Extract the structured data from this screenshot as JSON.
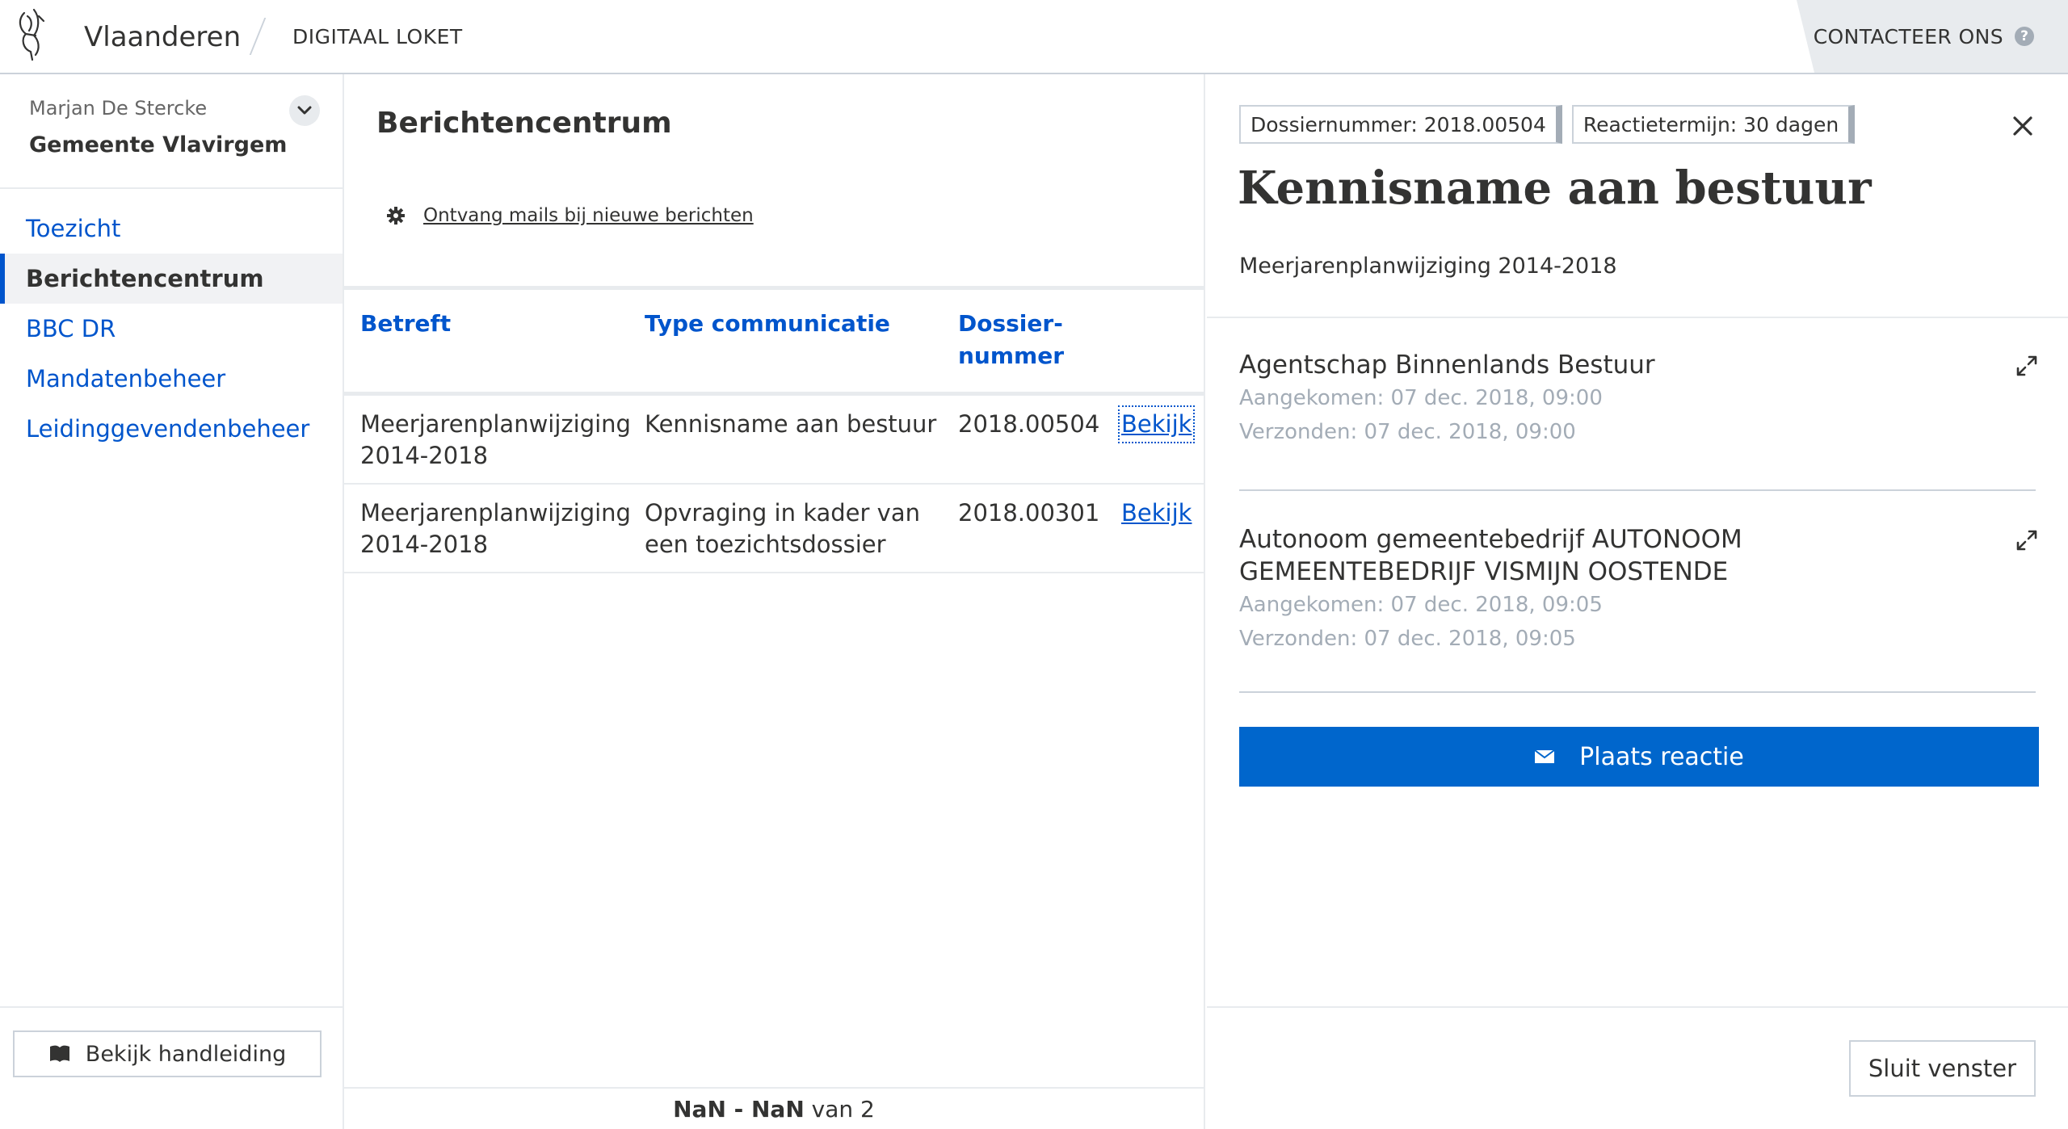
{
  "header": {
    "brand": "Vlaanderen",
    "product": "DIGITAAL LOKET",
    "contact_label": "CONTACTEER ONS",
    "help_glyph": "?"
  },
  "sidebar": {
    "user_name": "Marjan De Stercke",
    "organization": "Gemeente Vlavirgem",
    "nav": [
      {
        "label": "Toezicht",
        "active": false
      },
      {
        "label": "Berichtencentrum",
        "active": true
      },
      {
        "label": "BBC DR",
        "active": false
      },
      {
        "label": "Mandatenbeheer",
        "active": false
      },
      {
        "label": "Leidinggevendenbeheer",
        "active": false
      }
    ],
    "manual_button": "Bekijk handleiding"
  },
  "messages_panel": {
    "title": "Berichtencentrum",
    "mail_settings_link": "Ontvang mails bij nieuwe berichten",
    "columns": {
      "subject": "Betreft",
      "type": "Type communicatie",
      "dossier_line1": "Dossier-",
      "dossier_line2": "nummer"
    },
    "rows": [
      {
        "subject_l1": "Meerjarenplanwijziging",
        "subject_l2": "2014-2018",
        "type_l1": "Kennisname aan bestuur",
        "type_l2": "",
        "dossier": "2018.00504",
        "action": "Bekijk"
      },
      {
        "subject_l1": "Meerjarenplanwijziging",
        "subject_l2": "2014-2018",
        "type_l1": "Opvraging in kader van",
        "type_l2": "een toezichtsdossier",
        "dossier": "2018.00301",
        "action": "Bekijk"
      }
    ],
    "pager": {
      "range": "NaN - NaN",
      "of_label": "van",
      "total": "2"
    }
  },
  "detail_panel": {
    "dossier_tag": "Dossiernummer: 2018.00504",
    "reaction_tag": "Reactietermijn: 30 dagen",
    "title": "Kennisname aan bestuur",
    "subtitle": "Meerjarenplanwijziging 2014-2018",
    "messages": [
      {
        "from_l1": "Agentschap Binnenlands Bestuur",
        "from_l2": "",
        "received": "Aangekomen: 07 dec. 2018, 09:00",
        "sent": "Verzonden: 07 dec. 2018, 09:00"
      },
      {
        "from_l1": "Autonoom gemeentebedrijf AUTONOOM",
        "from_l2": "GEMEENTEBEDRIJF VISMIJN OOSTENDE",
        "received": "Aangekomen: 07 dec. 2018, 09:05",
        "sent": "Verzonden: 07 dec. 2018, 09:05"
      }
    ],
    "reply_button": "Plaats reactie",
    "close_window_button": "Sluit venster"
  },
  "colors": {
    "accent": "#0055cc",
    "button_primary": "#0066cc",
    "border": "#cbd2da",
    "muted_text": "#a3acb6"
  },
  "icons": [
    "flemish-lion-logo",
    "help-icon",
    "chevron-down-icon",
    "gear-icon",
    "book-icon",
    "close-icon",
    "expand-icon",
    "envelope-icon"
  ]
}
